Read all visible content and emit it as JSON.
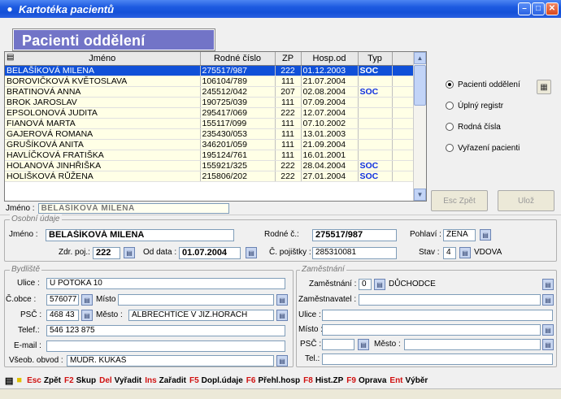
{
  "window": {
    "title": "Kartotéka pacientů",
    "icon": "patient-icon"
  },
  "banner": "Pacienti oddělení",
  "grid": {
    "columns": [
      "Jméno",
      "Rodné číslo",
      "ZP",
      "Hosp.od",
      "Typ"
    ],
    "rows": [
      {
        "jmeno": "BELAŠÍKOVÁ MILENA",
        "rc": "275517/987",
        "zp": "222",
        "hosp": "01.12.2003",
        "typ": "SOC"
      },
      {
        "jmeno": "BOROVIČKOVÁ KVĚTOSLAVA",
        "rc": "106104/789",
        "zp": "111",
        "hosp": "21.07.2004",
        "typ": ""
      },
      {
        "jmeno": "BRATINOVÁ ANNA",
        "rc": "245512/042",
        "zp": "207",
        "hosp": "02.08.2004",
        "typ": "SOC"
      },
      {
        "jmeno": "BROK JAROSLAV",
        "rc": "190725/039",
        "zp": "111",
        "hosp": "07.09.2004",
        "typ": ""
      },
      {
        "jmeno": "EPSOLONOVÁ JUDITA",
        "rc": "295417/069",
        "zp": "222",
        "hosp": "12.07.2004",
        "typ": ""
      },
      {
        "jmeno": "FIANOVÁ MARTA",
        "rc": "155117/099",
        "zp": "111",
        "hosp": "07.10.2002",
        "typ": ""
      },
      {
        "jmeno": "GAJEROVÁ ROMANA",
        "rc": "235430/053",
        "zp": "111",
        "hosp": "13.01.2003",
        "typ": ""
      },
      {
        "jmeno": "GRUŠÍKOVÁ ANITA",
        "rc": "346201/059",
        "zp": "111",
        "hosp": "21.09.2004",
        "typ": ""
      },
      {
        "jmeno": "HAVLÍČKOVÁ FRATIŠKA",
        "rc": "195124/761",
        "zp": "111",
        "hosp": "16.01.2001",
        "typ": ""
      },
      {
        "jmeno": "HOLANOVÁ JINHŘIŠKA",
        "rc": "155921/325",
        "zp": "222",
        "hosp": "28.04.2004",
        "typ": "SOC"
      },
      {
        "jmeno": "HOLIŠKOVÁ RŮŽENA",
        "rc": "215806/202",
        "zp": "222",
        "hosp": "27.01.2004",
        "typ": "SOC"
      }
    ]
  },
  "selected_name": {
    "label": "Jméno :",
    "value": "BELAŠÍKOVÁ MILENA"
  },
  "view_options": [
    {
      "label": "Pacienti oddělení",
      "checked": true
    },
    {
      "label": "Úplný registr",
      "checked": false
    },
    {
      "label": "Rodná čísla",
      "checked": false
    },
    {
      "label": "Vyřazení pacienti",
      "checked": false
    }
  ],
  "buttons": {
    "esc": "Esc Zpět",
    "save": "Ulož"
  },
  "osobni": {
    "legend": "Osobní údaje",
    "jmeno_label": "Jméno :",
    "jmeno": "BELAŠÍKOVÁ MILENA",
    "rc_label": "Rodné č.:",
    "rc": "275517/987",
    "pohlavi_label": "Pohlaví :",
    "pohlavi": "ŽENA",
    "zdrpoj_label": "Zdr. poj.:",
    "zdrpoj": "222",
    "oddata_label": "Od data :",
    "oddata": "01.07.2004",
    "cpoj_label": "Č. pojištky :",
    "cpoj": "285310081",
    "stav_label": "Stav :",
    "stav_code": "4",
    "stav": "VDOVA"
  },
  "bydliste": {
    "legend": "Bydliště",
    "ulice_label": "Ulice :",
    "ulice": "U POTOKA 10",
    "cobce_label": "Č.obce :",
    "cobce": "576077",
    "misto_label": "Místo :",
    "misto": "",
    "psc_label": "PSČ :",
    "psc": "468 43",
    "mesto_label": "Město :",
    "mesto": "ALBRECHTICE V JIZ.HORÁCH",
    "telef_label": "Telef.:",
    "telef": "546 123 875",
    "email_label": "E-mail :",
    "email": "",
    "obvod_label": "Všeob. obvod :",
    "obvod": "MUDR.  KUKÁŠ"
  },
  "zamestnani": {
    "legend": "Zaměstnání",
    "zam_label": "Zaměstnání :",
    "zam_code": "0",
    "zam": "DŮCHODCE",
    "zamestnavatel_label": "Zaměstnavatel :",
    "zamestnavatel": "",
    "ulice_label": "Ulice :",
    "ulice": "",
    "misto_label": "Místo :",
    "misto": "",
    "psc_label": "PSČ :",
    "psc": "",
    "mesto_label": "Město :",
    "mesto": "",
    "tel_label": "Tel.:",
    "tel": ""
  },
  "funcbar": [
    {
      "key": "Esc",
      "label": "Zpět"
    },
    {
      "key": "F2",
      "label": "Skup"
    },
    {
      "key": "Del",
      "label": "Vyřadit"
    },
    {
      "key": "Ins",
      "label": "Zařadit"
    },
    {
      "key": "F5",
      "label": "Dopl.údaje"
    },
    {
      "key": "F6",
      "label": "Přehl.hosp"
    },
    {
      "key": "F8",
      "label": "Hist.ZP"
    },
    {
      "key": "F9",
      "label": "Oprava"
    },
    {
      "key": "Ent",
      "label": "Výběr"
    }
  ],
  "colors": {
    "titlebar": "#1450d8",
    "banner": "#7274c7",
    "selection": "#1050d8",
    "row_bg": "#ffffe6",
    "key_red": "#d01010",
    "typ_blue": "#1030e0"
  }
}
